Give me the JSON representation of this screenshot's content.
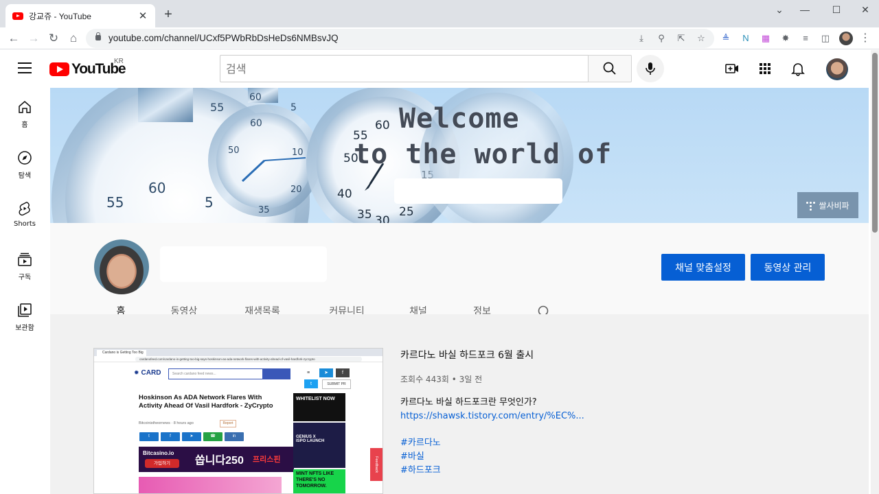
{
  "browser": {
    "tab_title": "강교쥬 - YouTube",
    "tab_close": "✕",
    "new_tab": "+",
    "url": "youtube.com/channel/UCxf5PWbRbDsHeDs6NMBsvJQ",
    "window_controls": {
      "minimize": "—",
      "maximize": "☐",
      "close": "✕",
      "dropdown": "⌄"
    }
  },
  "youtube": {
    "logo_text": "YouTube",
    "country_code": "KR",
    "search_placeholder": "검색",
    "guide": [
      {
        "label": "홈",
        "icon": "home-icon"
      },
      {
        "label": "탐색",
        "icon": "explore-icon"
      },
      {
        "label": "Shorts",
        "icon": "shorts-icon"
      },
      {
        "label": "구독",
        "icon": "subscriptions-icon"
      },
      {
        "label": "보관함",
        "icon": "library-icon"
      }
    ]
  },
  "banner": {
    "line1": "Welcome",
    "line2": "to the world of",
    "link_label": "쌀사비파"
  },
  "channel": {
    "customize_button": "채널 맞춤설정",
    "manage_videos_button": "동영상 관리",
    "tabs": [
      "홈",
      "동영상",
      "재생목록",
      "커뮤니티",
      "채널",
      "정보"
    ]
  },
  "featured_video": {
    "title": "카르다노 바실 하드포크 6월 출시",
    "meta": "조회수 443회 • 3일 전",
    "description_line": "카르다노 바실 하드포크란 무엇인가?",
    "link": "https://shawsk.tistory.com/entry/%EC%...",
    "hashtags": [
      "#카르다노",
      "#바실",
      "#하드포크"
    ],
    "thumbnail": {
      "tab_text": "Cardano is Getting Too Big ...",
      "url_text": "cardanofeed.com/cardano-is-getting-too-big-says-hoskinson-as-ada-network-flares-with-activity-ahead-of-vasil-hardfork-zycrypto",
      "site_name": "CARD",
      "site_sub": "FEE",
      "search_placeholder": "Search cardano feed news...",
      "submit_label": "SUBMIT PR",
      "headline": "Hoskinson As ADA Network Flares With Activity Ahead Of Vasil Hardfork - ZyCrypto",
      "source": "Bitcoinistheornews  ·  8 hours ago",
      "report": "Report",
      "promo_logo": "Bitcasino.io",
      "promo_join": "가입하기",
      "promo_big": "쏩니다250",
      "promo_free": "프리스핀",
      "ad1": "WHITELIST NOW",
      "ad2": "GENIUS X ISPO LAUNCH",
      "ad3": "MINT NFTS LIKE THERE'S NO TOMORROW.",
      "feedback": "Feedback"
    }
  }
}
